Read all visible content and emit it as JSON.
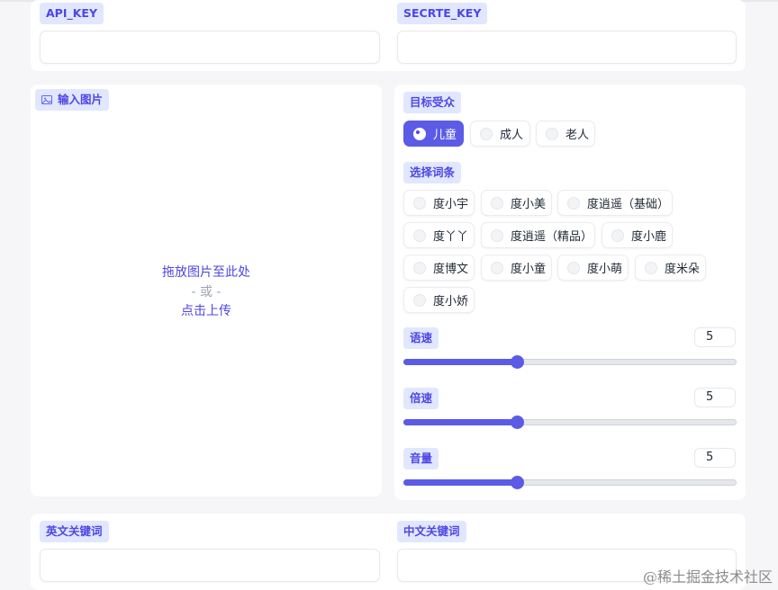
{
  "keys": {
    "api_key_label": "API_KEY",
    "api_key_value": "",
    "secret_key_label": "SECRTE_KEY",
    "secret_key_value": ""
  },
  "image_input": {
    "label": "输入图片",
    "icon": "image-icon",
    "drop_text": "拖放图片至此处",
    "or_text": "- 或 -",
    "click_text": "点击上传"
  },
  "audience": {
    "label": "目标受众",
    "options": [
      "儿童",
      "成人",
      "老人"
    ],
    "selected": "儿童"
  },
  "voice": {
    "label": "选择词条",
    "options": [
      "度小宇",
      "度小美",
      "度逍遥（基础）",
      "度丫丫",
      "度逍遥（精品）",
      "度小鹿",
      "度博文",
      "度小童",
      "度小萌",
      "度米朵",
      "度小娇"
    ]
  },
  "sliders": {
    "speed": {
      "label": "语速",
      "value": "5"
    },
    "rate": {
      "label": "倍速",
      "value": "5"
    },
    "volume": {
      "label": "音量",
      "value": "5"
    }
  },
  "keywords": {
    "english_label": "英文关键词",
    "english_value": "",
    "chinese_label": "中文关键词",
    "chinese_value": ""
  },
  "watermark": "@稀土掘金技术社区",
  "colors": {
    "accent": "#5b5be6",
    "badge_bg": "#e0e7ff",
    "badge_text": "#4f46e5"
  }
}
